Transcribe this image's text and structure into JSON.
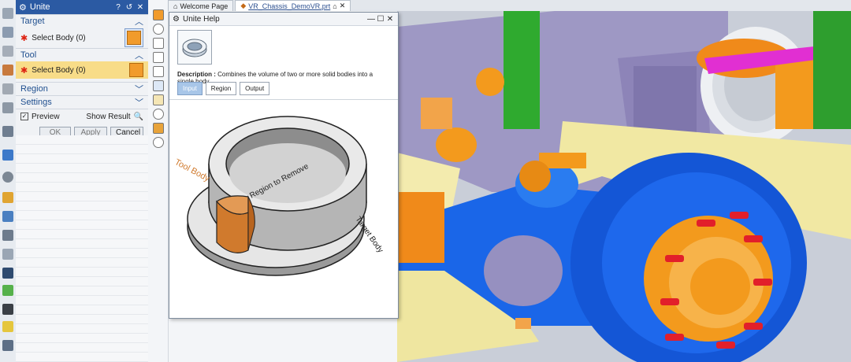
{
  "dialog": {
    "title": "Unite",
    "target": {
      "header": "Target",
      "select_label": "Select Body (0)"
    },
    "tool": {
      "header": "Tool",
      "select_label": "Select Body (0)"
    },
    "region": {
      "header": "Region"
    },
    "settings": {
      "header": "Settings"
    },
    "preview_label": "Preview",
    "show_result_label": "Show Result",
    "ok_label": "OK",
    "apply_label": "Apply",
    "cancel_label": "Cancel"
  },
  "tabs": [
    {
      "label": "Welcome Page"
    },
    {
      "label": "VR_Chassis_DemoVR.prt"
    }
  ],
  "help": {
    "title": "Unite Help",
    "description_label": "Description :",
    "description_text": "Combines the volume of two or more solid bodies into a single body.",
    "tabs": [
      {
        "label": "Input"
      },
      {
        "label": "Region"
      },
      {
        "label": "Output"
      }
    ],
    "illustration": {
      "tool_body": "Tool Body",
      "region_to_remove": "Region to Remove",
      "target_body": "Target Body"
    }
  },
  "colors": {
    "title_bar": "#2b5aa3",
    "active_row": "#f8dc88",
    "tool_body": "#e0893b",
    "axle_blue": "#1a66e8",
    "hub_orange": "#f39a1d",
    "frame_yellow": "#f1e8a3",
    "spring_green": "#2faa2f",
    "bracket_purple": "#8f86b8"
  }
}
